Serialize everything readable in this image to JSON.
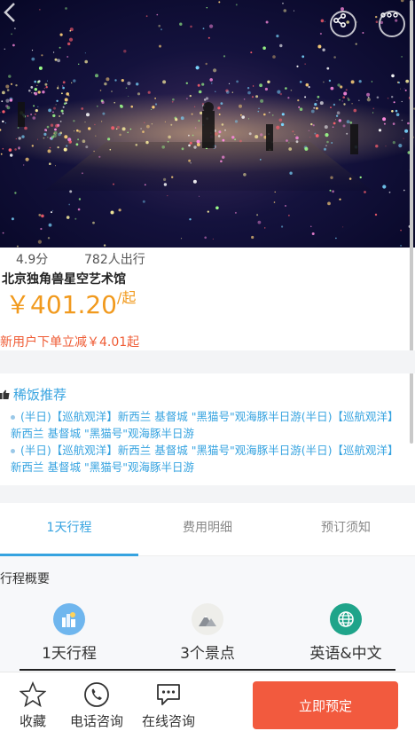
{
  "stats": {
    "rating": "4.9分",
    "travelers": "782人出行"
  },
  "product": {
    "title": "北京独角兽星空艺术馆"
  },
  "price": {
    "amount": "￥401.20",
    "unit": "/起"
  },
  "discount": "新用户下单立减￥4.01起",
  "recommend": {
    "title": "稀饭推荐",
    "items": [
      "(半日)【巡航观洋】新西兰 基督城 \"黑猫号\"观海豚半日游(半日)【巡航观洋】新西兰 基督城 \"黑猫号\"观海豚半日游",
      "(半日)【巡航观洋】新西兰 基督城 \"黑猫号\"观海豚半日游(半日)【巡航观洋】新西兰 基督城 \"黑猫号\"观海豚半日游"
    ]
  },
  "tabs": [
    "1天行程",
    "费用明细",
    "预订须知"
  ],
  "overview": {
    "title": "行程概要",
    "features": [
      {
        "label": "1天行程",
        "icon": "city-icon"
      },
      {
        "label": "3个景点",
        "icon": "mountain-icon"
      },
      {
        "label": "英语&中文",
        "icon": "globe-icon"
      }
    ]
  },
  "bottom_bar": {
    "favorite": "收藏",
    "phone": "电话咨询",
    "online": "在线咨询",
    "book": "立即预定"
  },
  "colors": {
    "accent": "#36a3e0",
    "price": "#f19a1e",
    "discount": "#ef5b34",
    "book": "#f25a3e"
  }
}
